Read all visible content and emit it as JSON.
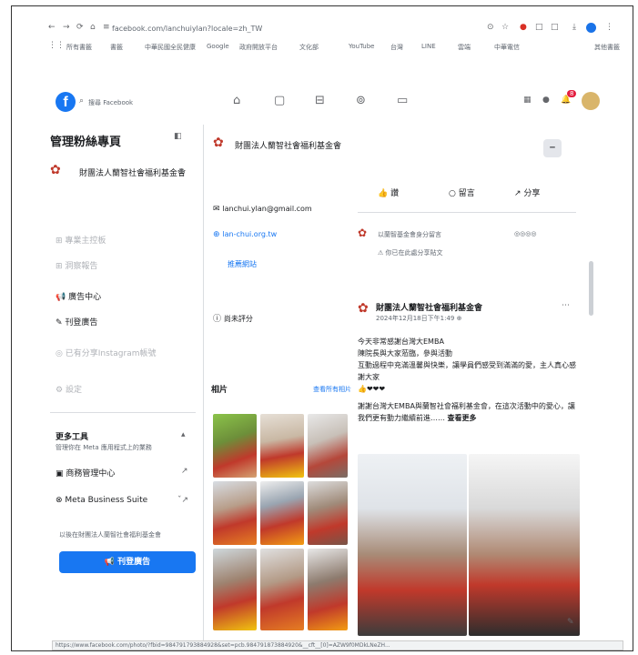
{
  "browser": {
    "url": "facebook.com/lanchuiylan?locale=zh_TW",
    "bookmarks": [
      "所有書籤",
      "書籤",
      "中華民國全民健康",
      "Google",
      "政府開放平台",
      "文化部",
      "YouTube",
      "台灣",
      "LINE",
      "雲端",
      "中華電信",
      "其他書籤"
    ],
    "status_url": "https://www.facebook.com/photo/?fbid=984791793884928&set=pcb.984791873884920&__cft__[0]=AZW9f0MDkLNeZH..."
  },
  "fb": {
    "search_placeholder": "搜尋 Facebook",
    "notification_count": "8"
  },
  "sidebar": {
    "title": "管理粉絲專頁",
    "page_name": "財團法人蘭智社會福利基金會",
    "items": [
      "專業主控板",
      "洞察報告",
      "廣告中心",
      "刊登廣告",
      "已有分享Instagram帳號",
      "設定"
    ],
    "more_tools_title": "更多工具",
    "more_tools_sub": "管理你在 Meta 應用程式上的業務",
    "tools": [
      "商務管理中心",
      "Meta Business Suite"
    ],
    "promote_note": "以後在財團法人蘭智社會福利基金會",
    "promote_button": "刊登廣告"
  },
  "main": {
    "page_header": "財團法人蘭智社會福利基金會",
    "email": "lanchui.ylan@gmail.com",
    "website": "lan-chui.org.tw",
    "edit_link": "推薦網站",
    "rating": "尚未評分",
    "photos_title": "相片",
    "see_all": "查看所有相片"
  },
  "post_actions": [
    "讚",
    "留言",
    "分享"
  ],
  "comment": {
    "author": "以蘭智基金會身分留言",
    "note": "你已在此處分享貼文"
  },
  "post": {
    "author": "財團法人蘭智社會福利基金會",
    "time": "2024年12月18日下午1:49",
    "lines": [
      "今天非常感謝台灣大EMBA",
      "陳院長與大家蒞臨，參與活動",
      "互動過程中充滿溫馨與快樂，讓學員們感受到滿滿的愛，主人真心感謝大家",
      "👍❤❤❤"
    ],
    "body2": "謝謝台灣大EMBA與蘭智社會福利基金會，在這次活動中的愛心，讓我們更有動力繼續前進……",
    "see_more": "查看更多"
  }
}
